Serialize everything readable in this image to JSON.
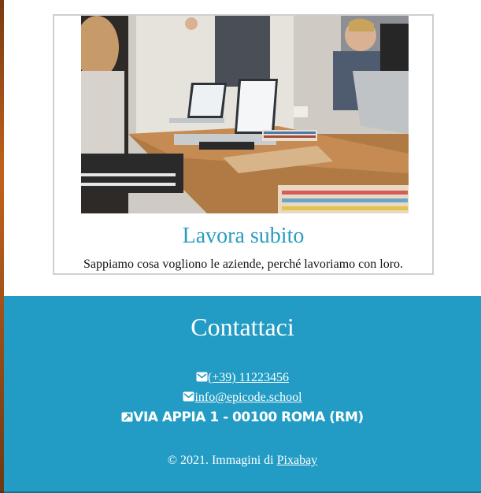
{
  "card": {
    "image_alt": "Team meeting with laptops around a wooden table",
    "title": "Lavora subito",
    "text": "Sappiamo cosa vogliono le aziende, perché lavoriamo con loro."
  },
  "footer": {
    "title": "Contattaci",
    "phone": "(+39) 11223456",
    "email": "info@epicode.school",
    "address": "VIA APPIA 1 - 00100 ROMA (RM)",
    "copyright_prefix": "© 2021. Immagini di ",
    "copyright_link": "Pixabay",
    "icons": {
      "phone": "envelope-icon",
      "email": "envelope-icon",
      "address": "map-marker-icon"
    }
  },
  "colors": {
    "accent": "#2a9cc2",
    "footer_bg": "#229cc4",
    "card_border": "#cfcfcf"
  }
}
